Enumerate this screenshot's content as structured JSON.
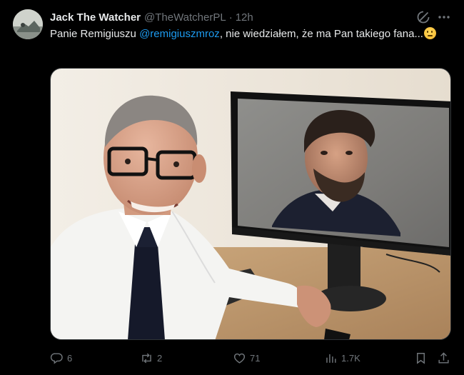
{
  "author": {
    "display_name": "Jack The Watcher",
    "handle": "@TheWatcherPL",
    "separator": "·",
    "time": "12h"
  },
  "tweet": {
    "text_prefix": "Panie Remigiuszu ",
    "mention": "@remigiuszmroz",
    "text_suffix": ", nie wiedziałem, że ma Pan takiego fana...",
    "emoji": "thinking-face"
  },
  "actions": {
    "replies": "6",
    "reposts": "2",
    "likes": "71",
    "views": "1.7K"
  },
  "icons": {
    "grok": "grok-icon",
    "more": "more-dots-icon",
    "reply": "reply-icon",
    "repost": "repost-icon",
    "like": "heart-icon",
    "views": "views-bar-icon",
    "bookmark": "bookmark-icon",
    "share": "share-icon"
  },
  "colors": {
    "background": "#000000",
    "text": "#e7e9ea",
    "secondary": "#71767b",
    "link": "#1d9bf0"
  }
}
